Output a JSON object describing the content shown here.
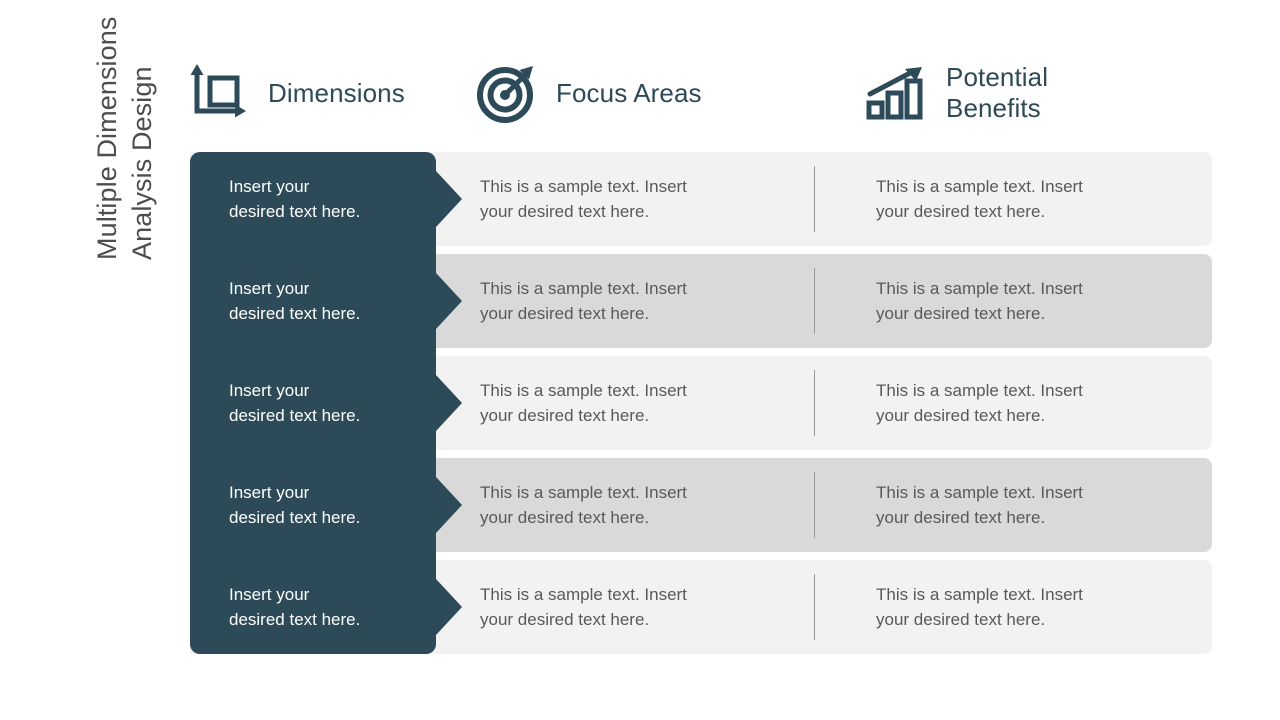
{
  "slide": {
    "title_line1": "Multiple Dimensions",
    "title_line2": "Analysis Design",
    "background_color": "#ffffff"
  },
  "theme": {
    "accent_dark": "#2c4a57",
    "header_text": "#2e4a57",
    "body_text": "#595959",
    "row_light": "#f2f2f2",
    "row_alt": "#d9d9d9",
    "panel_text": "#ffffff",
    "divider": "#9a9a9a"
  },
  "columns": [
    {
      "id": "dimensions",
      "label": "Dimensions",
      "label_line2": "",
      "icon": "axes-square-icon"
    },
    {
      "id": "focus_areas",
      "label": "Focus Areas",
      "label_line2": "",
      "icon": "target-arrow-icon"
    },
    {
      "id": "potential_benefits",
      "label": "Potential",
      "label_line2": "Benefits",
      "icon": "bar-chart-growth-icon"
    }
  ],
  "rows": [
    {
      "dimension": "Insert your\ndesired text here.",
      "dimension_line1": "Insert your",
      "dimension_line2": "desired text here.",
      "focus_area": "This is a sample text. Insert your desired text here.",
      "focus_line1": "This is a sample text. Insert",
      "focus_line2": "your desired text here.",
      "benefit": "This is a sample text. Insert your desired text here.",
      "benefit_line1": "This is a sample text. Insert",
      "benefit_line2": "your desired text here.",
      "shade": "light"
    },
    {
      "dimension": "Insert your\ndesired text here.",
      "dimension_line1": "Insert your",
      "dimension_line2": "desired text here.",
      "focus_area": "This is a sample text. Insert your desired text here.",
      "focus_line1": "This is a sample text. Insert",
      "focus_line2": "your desired text here.",
      "benefit": "This is a sample text. Insert your desired text here.",
      "benefit_line1": "This is a sample text. Insert",
      "benefit_line2": "your desired text here.",
      "shade": "alt"
    },
    {
      "dimension": "Insert your\ndesired text here.",
      "dimension_line1": "Insert your",
      "dimension_line2": "desired text here.",
      "focus_area": "This is a sample text. Insert your desired text here.",
      "focus_line1": "This is a sample text. Insert",
      "focus_line2": "your desired text here.",
      "benefit": "This is a sample text. Insert your desired text here.",
      "benefit_line1": "This is a sample text. Insert",
      "benefit_line2": "your desired text here.",
      "shade": "light"
    },
    {
      "dimension": "Insert your\ndesired text here.",
      "dimension_line1": "Insert your",
      "dimension_line2": "desired text here.",
      "focus_area": "This is a sample text. Insert your desired text here.",
      "focus_line1": "This is a sample text. Insert",
      "focus_line2": "your desired text here.",
      "benefit": "This is a sample text. Insert your desired text here.",
      "benefit_line1": "This is a sample text. Insert",
      "benefit_line2": "your desired text here.",
      "shade": "alt"
    },
    {
      "dimension": "Insert your\ndesired text here.",
      "dimension_line1": "Insert your",
      "dimension_line2": "desired text here.",
      "focus_area": "This is a sample text. Insert your desired text here.",
      "focus_line1": "This is a sample text. Insert",
      "focus_line2": "your desired text here.",
      "benefit": "This is a sample text. Insert your desired text here.",
      "benefit_line1": "This is a sample text. Insert",
      "benefit_line2": "your desired text here.",
      "shade": "light"
    }
  ]
}
